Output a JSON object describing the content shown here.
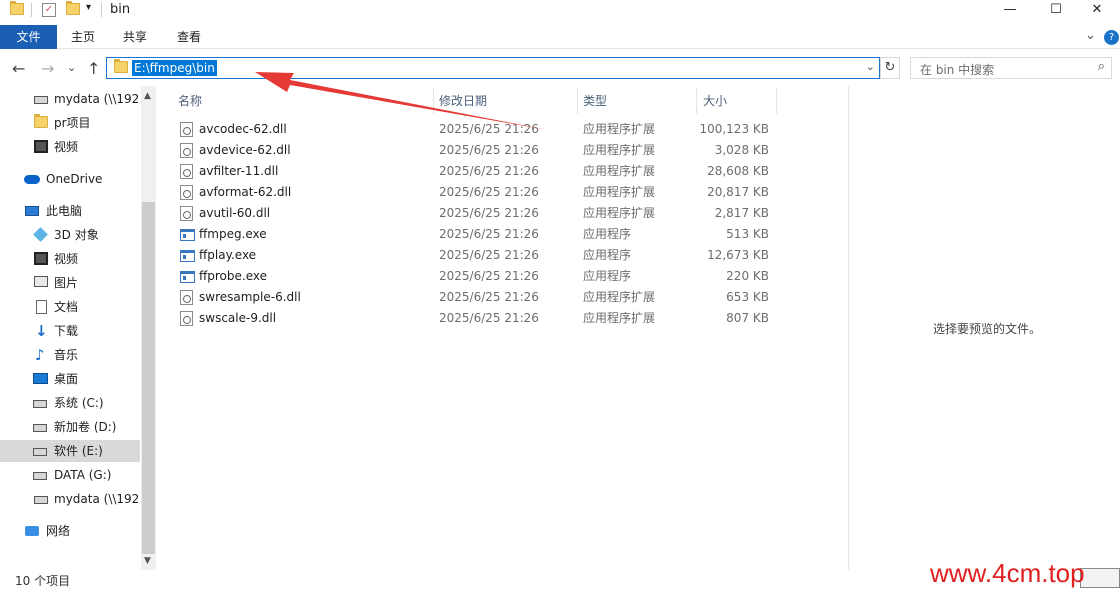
{
  "window": {
    "title": "bin",
    "minimize_glyph": "—",
    "maximize_glyph": "☐",
    "close_glyph": "✕",
    "collapse_ribbon_glyph": "⌄",
    "help_glyph": "?"
  },
  "ribbon": {
    "tabs": [
      "文件",
      "主页",
      "共享",
      "查看"
    ]
  },
  "nav": {
    "back_glyph": "←",
    "forward_glyph": "→",
    "recent_glyph": "⌄",
    "up_glyph": "↑",
    "address": "E:\\ffmpeg\\bin",
    "dropdown_glyph": "⌄",
    "refresh_glyph": "↻",
    "search_placeholder": "在 bin 中搜索",
    "search_glyph": "⌕"
  },
  "sidebar": {
    "items": [
      {
        "label": "mydata (\\\\192.",
        "icon": "network-drive-icon"
      },
      {
        "label": "pr项目",
        "icon": "folder-icon"
      },
      {
        "label": "视频",
        "icon": "video-icon"
      },
      {
        "label": "OneDrive",
        "icon": "onedrive-icon"
      },
      {
        "label": "此电脑",
        "icon": "computer-icon"
      },
      {
        "label": "3D 对象",
        "icon": "3d-objects-icon"
      },
      {
        "label": "视频",
        "icon": "video-icon"
      },
      {
        "label": "图片",
        "icon": "pictures-icon"
      },
      {
        "label": "文档",
        "icon": "documents-icon"
      },
      {
        "label": "下载",
        "icon": "download-icon"
      },
      {
        "label": "音乐",
        "icon": "music-icon"
      },
      {
        "label": "桌面",
        "icon": "desktop-icon"
      },
      {
        "label": "系统 (C:)",
        "icon": "system-drive-icon"
      },
      {
        "label": "新加卷 (D:)",
        "icon": "drive-icon"
      },
      {
        "label": "软件 (E:)",
        "icon": "drive-icon"
      },
      {
        "label": "DATA (G:)",
        "icon": "drive-icon"
      },
      {
        "label": "mydata (\\\\192.",
        "icon": "network-drive-icon"
      },
      {
        "label": "网络",
        "icon": "network-icon"
      }
    ],
    "selected_index": 14,
    "scroll_up_glyph": "▲",
    "scroll_down_glyph": "▼"
  },
  "filelist": {
    "columns": {
      "name": "名称",
      "date": "修改日期",
      "type": "类型",
      "size": "大小"
    },
    "sort_glyph": "^",
    "rows": [
      {
        "name": "avcodec-62.dll",
        "date": "2025/6/25 21:26",
        "type": "应用程序扩展",
        "size": "100,123 KB",
        "kind": "dll"
      },
      {
        "name": "avdevice-62.dll",
        "date": "2025/6/25 21:26",
        "type": "应用程序扩展",
        "size": "3,028 KB",
        "kind": "dll"
      },
      {
        "name": "avfilter-11.dll",
        "date": "2025/6/25 21:26",
        "type": "应用程序扩展",
        "size": "28,608 KB",
        "kind": "dll"
      },
      {
        "name": "avformat-62.dll",
        "date": "2025/6/25 21:26",
        "type": "应用程序扩展",
        "size": "20,817 KB",
        "kind": "dll"
      },
      {
        "name": "avutil-60.dll",
        "date": "2025/6/25 21:26",
        "type": "应用程序扩展",
        "size": "2,817 KB",
        "kind": "dll"
      },
      {
        "name": "ffmpeg.exe",
        "date": "2025/6/25 21:26",
        "type": "应用程序",
        "size": "513 KB",
        "kind": "exe"
      },
      {
        "name": "ffplay.exe",
        "date": "2025/6/25 21:26",
        "type": "应用程序",
        "size": "12,673 KB",
        "kind": "exe"
      },
      {
        "name": "ffprobe.exe",
        "date": "2025/6/25 21:26",
        "type": "应用程序",
        "size": "220 KB",
        "kind": "exe"
      },
      {
        "name": "swresample-6.dll",
        "date": "2025/6/25 21:26",
        "type": "应用程序扩展",
        "size": "653 KB",
        "kind": "dll"
      },
      {
        "name": "swscale-9.dll",
        "date": "2025/6/25 21:26",
        "type": "应用程序扩展",
        "size": "807 KB",
        "kind": "dll"
      }
    ]
  },
  "preview": {
    "text": "选择要预览的文件。"
  },
  "status": {
    "item_count": "10 个项目"
  },
  "watermark": "www.4cm.top",
  "colors": {
    "accent": "#1a5fb4",
    "selection": "#0078d7",
    "arrow": "#e53935"
  }
}
